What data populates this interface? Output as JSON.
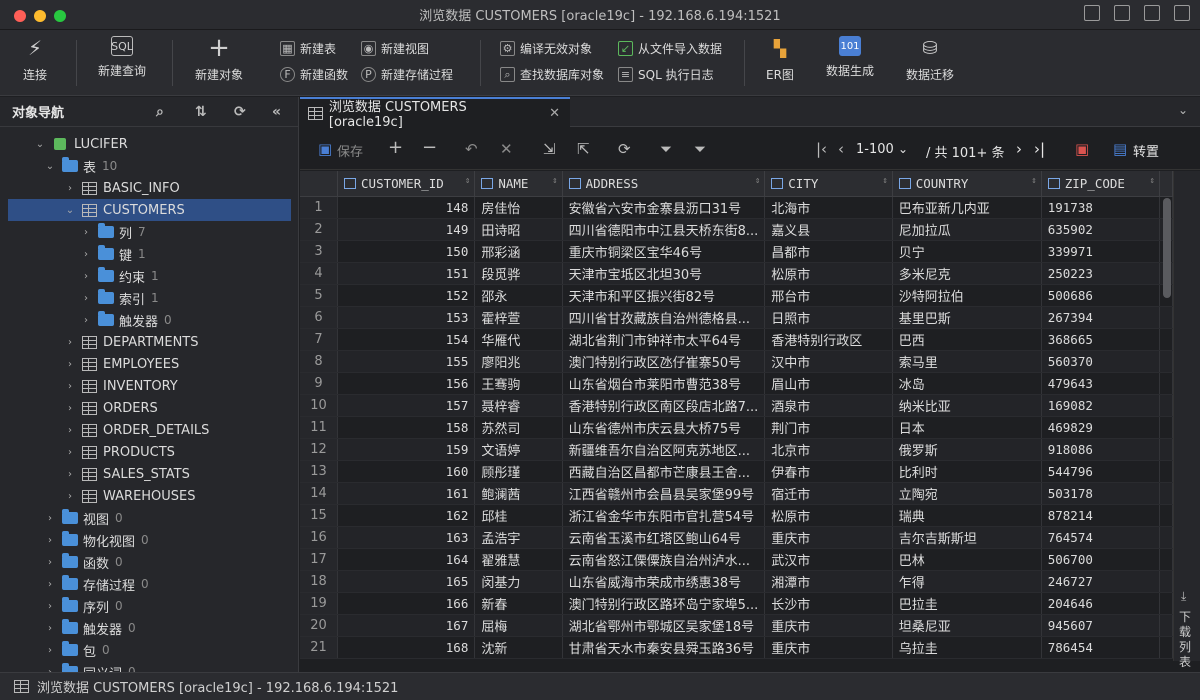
{
  "window": {
    "title": "浏览数据 CUSTOMERS [oracle19c]  - 192.168.6.194:1521"
  },
  "toolbar": {
    "connect": "连接",
    "new_query": "新建查询",
    "new_object": "新建对象",
    "new_table": "新建表",
    "new_view": "新建视图",
    "new_function": "新建函数",
    "new_procedure": "新建存储过程",
    "compile_invalid": "编译无效对象",
    "find_object": "查找数据库对象",
    "import_file": "从文件导入数据",
    "sql_log": "SQL 执行日志",
    "er": "ER图",
    "data_gen": "数据生成",
    "data_migrate": "数据迁移"
  },
  "nav": {
    "title": "对象导航",
    "connection": "LUCIFER",
    "tables_label": "表",
    "tables_count": "10",
    "tables": [
      "BASIC_INFO",
      "CUSTOMERS",
      "DEPARTMENTS",
      "EMPLOYEES",
      "INVENTORY",
      "ORDERS",
      "ORDER_DETAILS",
      "PRODUCTS",
      "SALES_STATS",
      "WAREHOUSES"
    ],
    "customers_children": [
      {
        "label": "列",
        "count": "7"
      },
      {
        "label": "键",
        "count": "1"
      },
      {
        "label": "约束",
        "count": "1"
      },
      {
        "label": "索引",
        "count": "1"
      },
      {
        "label": "触发器",
        "count": "0"
      }
    ],
    "other": [
      {
        "label": "视图",
        "count": "0"
      },
      {
        "label": "物化视图",
        "count": "0"
      },
      {
        "label": "函数",
        "count": "0"
      },
      {
        "label": "存储过程",
        "count": "0"
      },
      {
        "label": "序列",
        "count": "0"
      },
      {
        "label": "触发器",
        "count": "0"
      },
      {
        "label": "包",
        "count": "0"
      },
      {
        "label": "同义词",
        "count": "0"
      }
    ]
  },
  "tab": {
    "label": "浏览数据 CUSTOMERS [oracle19c]"
  },
  "grid_toolbar": {
    "save": "保存",
    "range": "1-100",
    "total": "/ 共 101+ 条",
    "transpose": "转置"
  },
  "grid": {
    "columns": [
      "CUSTOMER_ID",
      "NAME",
      "ADDRESS",
      "CITY",
      "COUNTRY",
      "ZIP_CODE"
    ],
    "rows": [
      [
        "1",
        "148",
        "房佳怡",
        "安徽省六安市金寨县沥口31号",
        "北海市",
        "巴布亚新几内亚",
        "191738"
      ],
      [
        "2",
        "149",
        "田诗昭",
        "四川省德阳市中江县天桥东街8...",
        "嘉义县",
        "尼加拉瓜",
        "635902"
      ],
      [
        "3",
        "150",
        "邢彩涵",
        "重庆市铜梁区宝华46号",
        "昌都市",
        "贝宁",
        "339971"
      ],
      [
        "4",
        "151",
        "段觅骅",
        "天津市宝坻区北坦30号",
        "松原市",
        "多米尼克",
        "250223"
      ],
      [
        "5",
        "152",
        "邵永",
        "天津市和平区振兴街82号",
        "邢台市",
        "沙特阿拉伯",
        "500686"
      ],
      [
        "6",
        "153",
        "霍梓萱",
        "四川省甘孜藏族自治州德格县...",
        "日照市",
        "基里巴斯",
        "267394"
      ],
      [
        "7",
        "154",
        "华雁代",
        "湖北省荆门市钟祥市太平64号",
        "香港特别行政区",
        "巴西",
        "368665"
      ],
      [
        "8",
        "155",
        "廖阳兆",
        "澳门特别行政区氹仔崔寨50号",
        "汉中市",
        "索马里",
        "560370"
      ],
      [
        "9",
        "156",
        "王骞驹",
        "山东省烟台市莱阳市曹范38号",
        "眉山市",
        "冰岛",
        "479643"
      ],
      [
        "10",
        "157",
        "聂梓睿",
        "香港特别行政区南区段店北路7...",
        "酒泉市",
        "纳米比亚",
        "169082"
      ],
      [
        "11",
        "158",
        "苏然司",
        "山东省德州市庆云县大桥75号",
        "荆门市",
        "日本",
        "469829"
      ],
      [
        "12",
        "159",
        "文语婷",
        "新疆维吾尔自治区阿克苏地区...",
        "北京市",
        "俄罗斯",
        "918086"
      ],
      [
        "13",
        "160",
        "顾彤瑾",
        "西藏自治区昌都市芒康县王舍...",
        "伊春市",
        "比利时",
        "544796"
      ],
      [
        "14",
        "161",
        "鲍澜茜",
        "江西省赣州市会昌县吴家堡99号",
        "宿迁市",
        "立陶宛",
        "503178"
      ],
      [
        "15",
        "162",
        "邱桂",
        "浙江省金华市东阳市官扎营54号",
        "松原市",
        "瑞典",
        "878214"
      ],
      [
        "16",
        "163",
        "孟浩宇",
        "云南省玉溪市红塔区鲍山64号",
        "重庆市",
        "吉尔吉斯斯坦",
        "764574"
      ],
      [
        "17",
        "164",
        "翟雅慧",
        "云南省怒江傈僳族自治州泸水...",
        "武汉市",
        "巴林",
        "506700"
      ],
      [
        "18",
        "165",
        "闵基力",
        "山东省威海市荣成市绣惠38号",
        "湘潭市",
        "乍得",
        "246727"
      ],
      [
        "19",
        "166",
        "新春",
        "澳门特别行政区路环岛宁家埠5...",
        "长沙市",
        "巴拉圭",
        "204646"
      ],
      [
        "20",
        "167",
        "屈梅",
        "湖北省鄂州市鄂城区吴家堡18号",
        "重庆市",
        "坦桑尼亚",
        "945607"
      ],
      [
        "21",
        "168",
        "沈新",
        "甘肃省天水市秦安县舜玉路36号",
        "重庆市",
        "乌拉圭",
        "786454"
      ]
    ]
  },
  "side_panel": {
    "download_list": "下载列表"
  },
  "status": {
    "text": "浏览数据 CUSTOMERS [oracle19c] - 192.168.6.194:1521"
  },
  "colors": {
    "accent": "#4a7fd4",
    "selection": "#2f4f86",
    "folder": "#4a90d9"
  }
}
